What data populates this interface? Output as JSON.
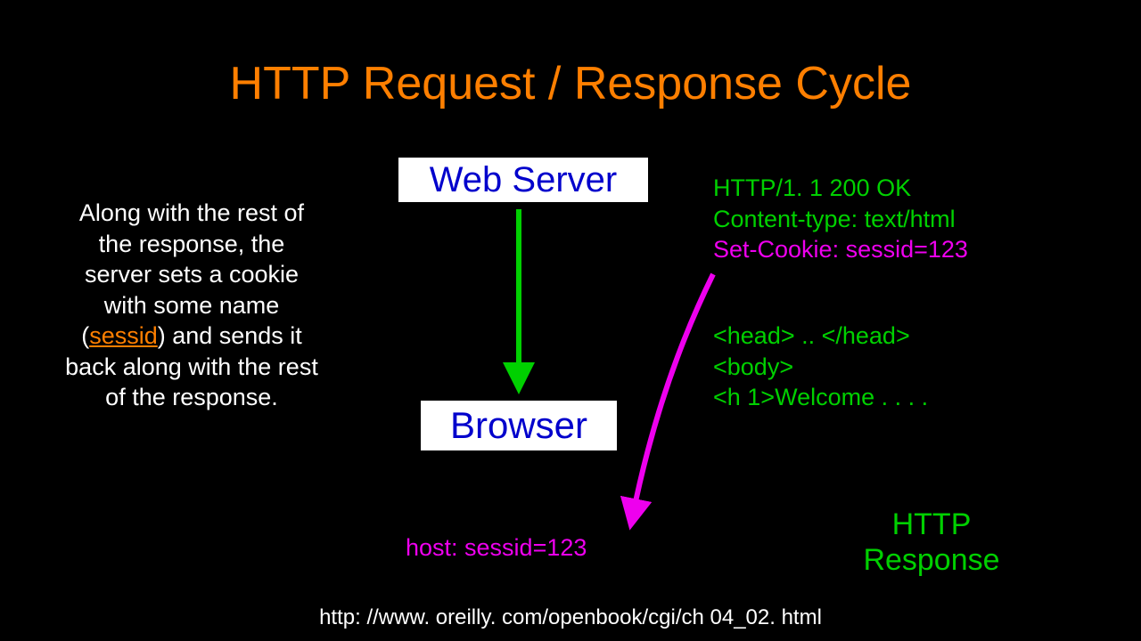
{
  "title": "HTTP Request / Response Cycle",
  "description": {
    "pre": "Along with the rest of the response, the server sets a cookie with some name (",
    "sessid": "sessid",
    "post": ") and sends it back along with the rest of the response."
  },
  "boxes": {
    "server": "Web Server",
    "browser": "Browser"
  },
  "response": {
    "status": "HTTP/1. 1 200 OK",
    "content_type": "Content-type: text/html",
    "set_cookie": "Set-Cookie: sessid=123",
    "body_head": "<head> .. </head>",
    "body_body": "<body>",
    "body_h1": "<h 1>Welcome . . . ."
  },
  "cookie_store": "host: sessid=123",
  "http_response_label": "HTTP Response",
  "footer_url": "http: //www. oreilly. com/openbook/cgi/ch 04_02. html"
}
